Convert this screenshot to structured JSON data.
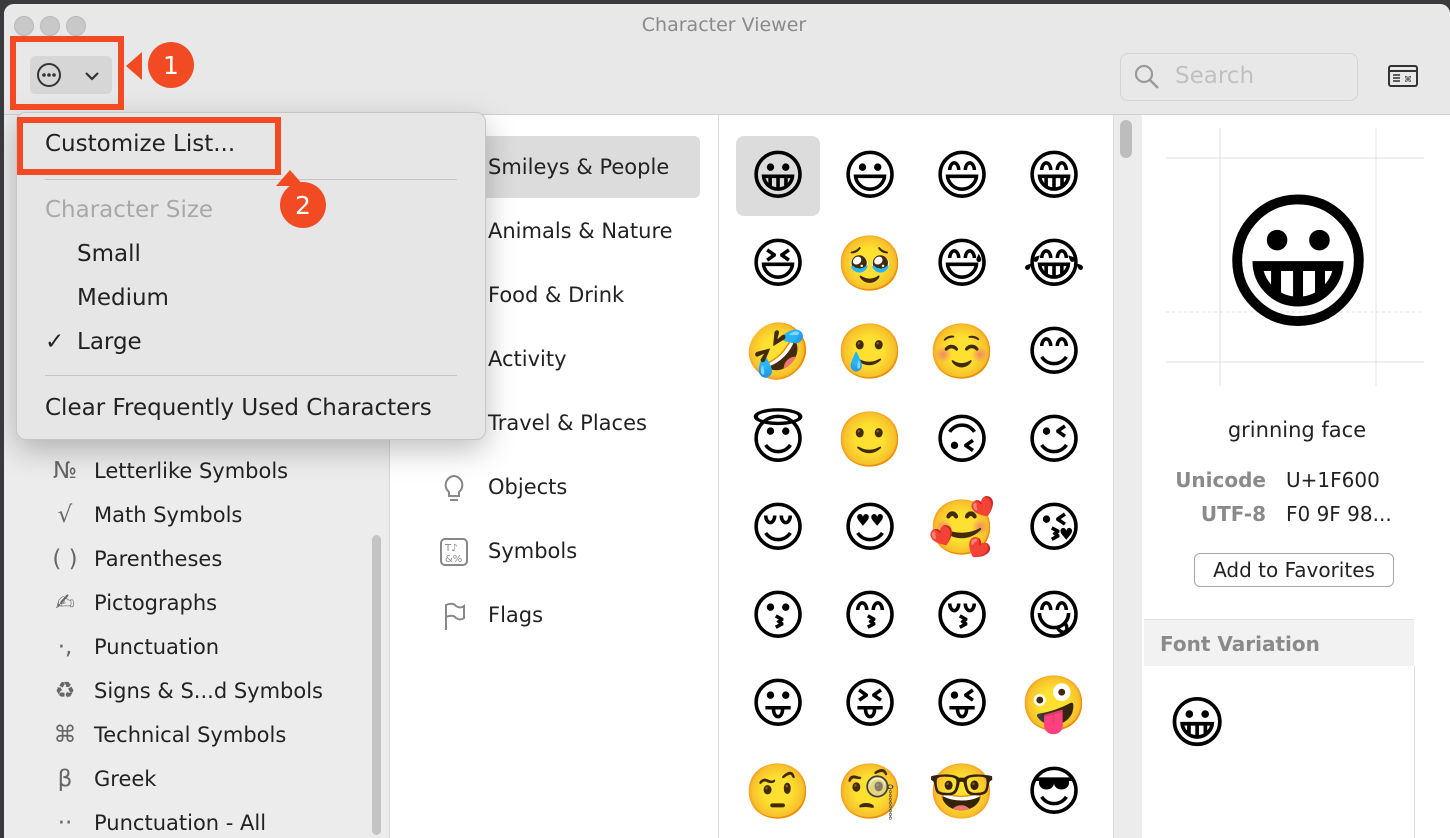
{
  "window": {
    "title": "Character Viewer"
  },
  "toolbar": {
    "search_placeholder": "Search"
  },
  "menu": {
    "customize": "Customize List...",
    "size_header": "Character Size",
    "small": "Small",
    "medium": "Medium",
    "large": "Large",
    "check": "✓",
    "clear": "Clear Frequently Used Characters"
  },
  "annotations": {
    "badge1": "1",
    "badge2": "2",
    "color": "#f24b24"
  },
  "sidebar": {
    "items": [
      {
        "glyph": "№",
        "label": "Letterlike Symbols"
      },
      {
        "glyph": "√",
        "label": "Math Symbols"
      },
      {
        "glyph": "( )",
        "label": "Parentheses"
      },
      {
        "glyph": "✍",
        "label": "Pictographs"
      },
      {
        "glyph": "·,",
        "label": "Punctuation"
      },
      {
        "glyph": "♻",
        "label": "Signs & S...d Symbols"
      },
      {
        "glyph": "⌘",
        "label": "Technical Symbols"
      },
      {
        "glyph": "β",
        "label": "Greek"
      },
      {
        "glyph": "··",
        "label": "Punctuation - All"
      }
    ]
  },
  "categories": [
    {
      "label": "Smileys & People",
      "icon": "smiley-icon",
      "selected": true
    },
    {
      "label": "Animals & Nature",
      "icon": "animal-icon"
    },
    {
      "label": "Food & Drink",
      "icon": "food-icon"
    },
    {
      "label": "Activity",
      "icon": "activity-icon"
    },
    {
      "label": "Travel & Places",
      "icon": "travel-icon"
    },
    {
      "label": "Objects",
      "icon": "lightbulb-icon"
    },
    {
      "label": "Symbols",
      "icon": "symbols-icon"
    },
    {
      "label": "Flags",
      "icon": "flag-icon"
    }
  ],
  "emoji_grid": [
    [
      "😀",
      "😃",
      "😄",
      "😁"
    ],
    [
      "😆",
      "🥹",
      "😅",
      "😂"
    ],
    [
      "🤣",
      "🥲",
      "☺️",
      "😊"
    ],
    [
      "😇",
      "🙂",
      "🙃",
      "😉"
    ],
    [
      "😌",
      "😍",
      "🥰",
      "😘"
    ],
    [
      "😗",
      "😙",
      "😚",
      "😋"
    ],
    [
      "😛",
      "😝",
      "😜",
      "🤪"
    ],
    [
      "🤨",
      "🧐",
      "🤓",
      "😎"
    ]
  ],
  "detail": {
    "emoji": "😀",
    "name": "grinning face",
    "unicode_label": "Unicode",
    "unicode_value": "U+1F600",
    "utf8_label": "UTF-8",
    "utf8_value": "F0 9F 98...",
    "favorites_button": "Add to Favorites",
    "font_variation_header": "Font Variation",
    "font_variation_emoji": "😀"
  }
}
